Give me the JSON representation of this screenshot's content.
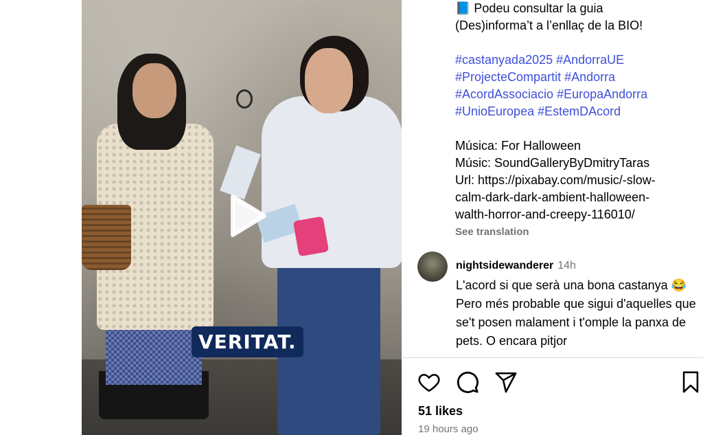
{
  "video": {
    "caption_badge": "VERITAT."
  },
  "caption": {
    "lines": [
      "📘 Podeu consultar la guia",
      "(Des)informa’t a l’enllaç de la BIO!"
    ],
    "hashtag_lines": [
      "#castanyada2025 #AndorraUE",
      "#ProjecteCompartit #Andorra",
      "#AcordAssociacio #EuropaAndorra",
      "#UnioEuropea #EstemDAcord"
    ],
    "music_lines": [
      "Música: For Halloween",
      "Músic: SoundGalleryByDmitryTaras",
      "Url: https://pixabay.com/music/-slow-",
      "calm-dark-dark-ambient-halloween-",
      "walth-horror-and-creepy-116010/"
    ],
    "see_translation": "See translation"
  },
  "comment": {
    "username": "nightsidewanderer",
    "time": "14h",
    "text": "L'acord si que serà una bona castanya 😂 Pero més probable que sigui d'aquelles que se't posen malament i t'omple la panxa de pets. O encara pitjor"
  },
  "actions": {
    "icons": [
      "heart-icon",
      "comment-icon",
      "share-icon",
      "bookmark-icon"
    ]
  },
  "likes": "51 likes",
  "posted": "19 hours ago",
  "colors": {
    "hashtag": "#3e4fd8",
    "muted": "#737373",
    "badge_bg": "#102a5b"
  }
}
